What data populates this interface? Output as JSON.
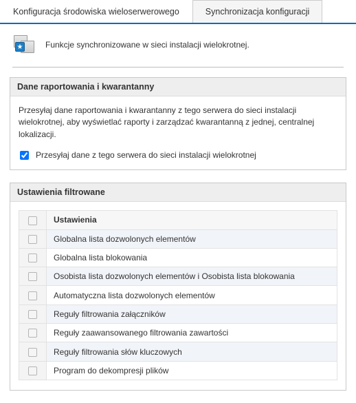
{
  "tabs": {
    "t0": "Konfiguracja środowiska wieloserwerowego",
    "t1": "Synchronizacja konfiguracji"
  },
  "intro": {
    "text": "Funkcje synchronizowane w sieci instalacji wielokrotnej."
  },
  "panel1": {
    "title": "Dane raportowania i kwarantanny",
    "desc": "Przesyłaj dane raportowania i kwarantanny z tego serwera do sieci instalacji wielokrotnej, aby wyświetlać raporty i zarządzać kwarantanną z jednej, centralnej lokalizacji.",
    "checkbox_label": "Przesyłaj dane z tego serwera do sieci instalacji wielokrotnej",
    "checkbox_checked": true
  },
  "panel2": {
    "title": "Ustawienia filtrowane",
    "col_header": "Ustawienia",
    "rows": [
      "Globalna lista dozwolonych elementów",
      "Globalna lista blokowania",
      "Osobista lista dozwolonych elementów i Osobista lista blokowania",
      "Automatyczna lista dozwolonych elementów",
      "Reguły filtrowania załączników",
      "Reguły zaawansowanego filtrowania zawartości",
      "Reguły filtrowania słów kluczowych",
      "Program do dekompresji plików"
    ]
  }
}
